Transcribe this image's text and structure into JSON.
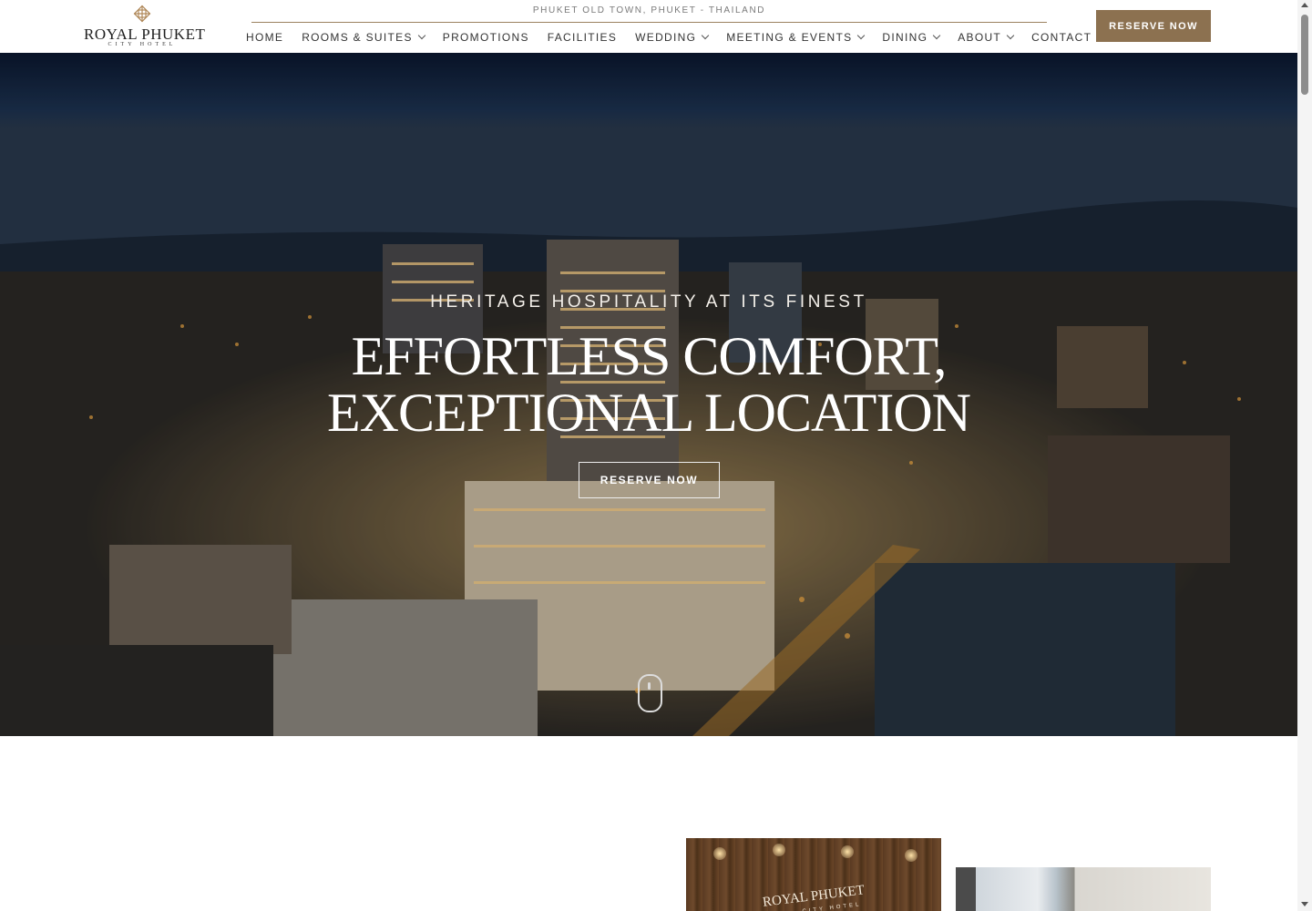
{
  "header": {
    "logo": {
      "name": "ROYAL PHUKET",
      "subtitle": "CITY HOTEL",
      "icon": "logo-emblem-icon"
    },
    "tagline": "PHUKET OLD TOWN, PHUKET - THAILAND",
    "nav": [
      {
        "label": "HOME",
        "has_dropdown": false
      },
      {
        "label": "ROOMS & SUITES",
        "has_dropdown": true
      },
      {
        "label": "PROMOTIONS",
        "has_dropdown": false
      },
      {
        "label": "FACILITIES",
        "has_dropdown": false
      },
      {
        "label": "WEDDING",
        "has_dropdown": true
      },
      {
        "label": "MEETING & EVENTS",
        "has_dropdown": true
      },
      {
        "label": "DINING",
        "has_dropdown": true
      },
      {
        "label": "ABOUT",
        "has_dropdown": true
      },
      {
        "label": "CONTACT",
        "has_dropdown": false
      }
    ],
    "reserve_label": "RESERVE NOW"
  },
  "hero": {
    "kicker": "HERITAGE HOSPITALITY AT ITS FINEST",
    "title_line1": "EFFORTLESS COMFORT,",
    "title_line2": "EXCEPTIONAL LOCATION",
    "button_label": "RESERVE NOW",
    "scroll_icon": "mouse-scroll-icon"
  },
  "gallery": {
    "lobby_sign": "ROYAL PHUKET",
    "lobby_sign_sub": "CITY HOTEL"
  },
  "colors": {
    "accent": "#8c7150",
    "rule": "#9c8260",
    "text": "#333333"
  }
}
